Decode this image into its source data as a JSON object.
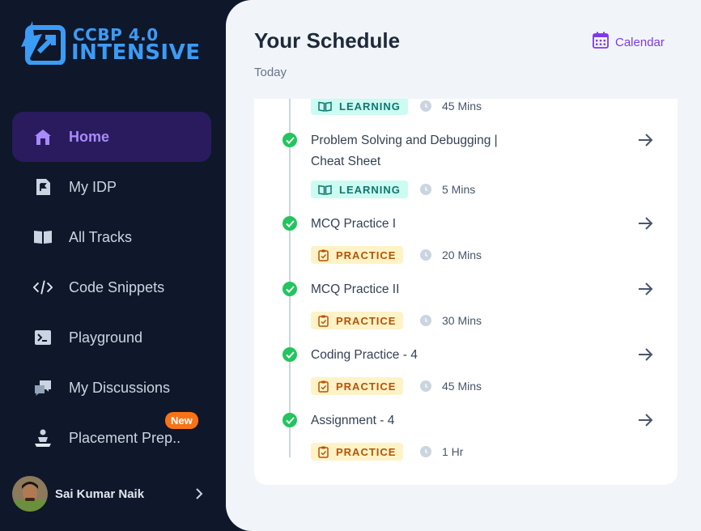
{
  "logo": {
    "line1": "CCBP 4.0",
    "line2": "INTENSIVE"
  },
  "nav": [
    {
      "label": "Home",
      "icon": "home-icon",
      "active": true
    },
    {
      "label": "My IDP",
      "icon": "flag-document-icon"
    },
    {
      "label": "All Tracks",
      "icon": "book-open-icon"
    },
    {
      "label": "Code Snippets",
      "icon": "code-icon"
    },
    {
      "label": "Playground",
      "icon": "terminal-icon"
    },
    {
      "label": "My Discussions",
      "icon": "chat-icon"
    },
    {
      "label": "Placement Prep..",
      "icon": "person-laptop-icon",
      "badge": "New"
    }
  ],
  "user": {
    "name": "Sai Kumar Naik"
  },
  "header": {
    "title": "Your Schedule",
    "subtitle": "Today",
    "calendar_label": "Calendar"
  },
  "schedule": [
    {
      "tag": "LEARNING",
      "duration": "45 Mins",
      "partial": true
    },
    {
      "title": "Problem Solving and Debugging | Cheat Sheet",
      "tag": "LEARNING",
      "duration": "5 Mins"
    },
    {
      "title": "MCQ Practice I",
      "tag": "PRACTICE",
      "duration": "20 Mins"
    },
    {
      "title": "MCQ Practice II",
      "tag": "PRACTICE",
      "duration": "30 Mins"
    },
    {
      "title": "Coding Practice - 4",
      "tag": "PRACTICE",
      "duration": "45 Mins"
    },
    {
      "title": "Assignment - 4",
      "tag": "PRACTICE",
      "duration": "1 Hr"
    }
  ],
  "colors": {
    "sidebar_bg": "#0f172a",
    "active_bg": "#2a1b5e",
    "accent": "#7c3aed",
    "logo_blue": "#3b9cf6",
    "check_green": "#22c55e",
    "learning_bg": "#ccfbf1",
    "practice_bg": "#fef3c7",
    "badge_orange": "#f97316"
  }
}
